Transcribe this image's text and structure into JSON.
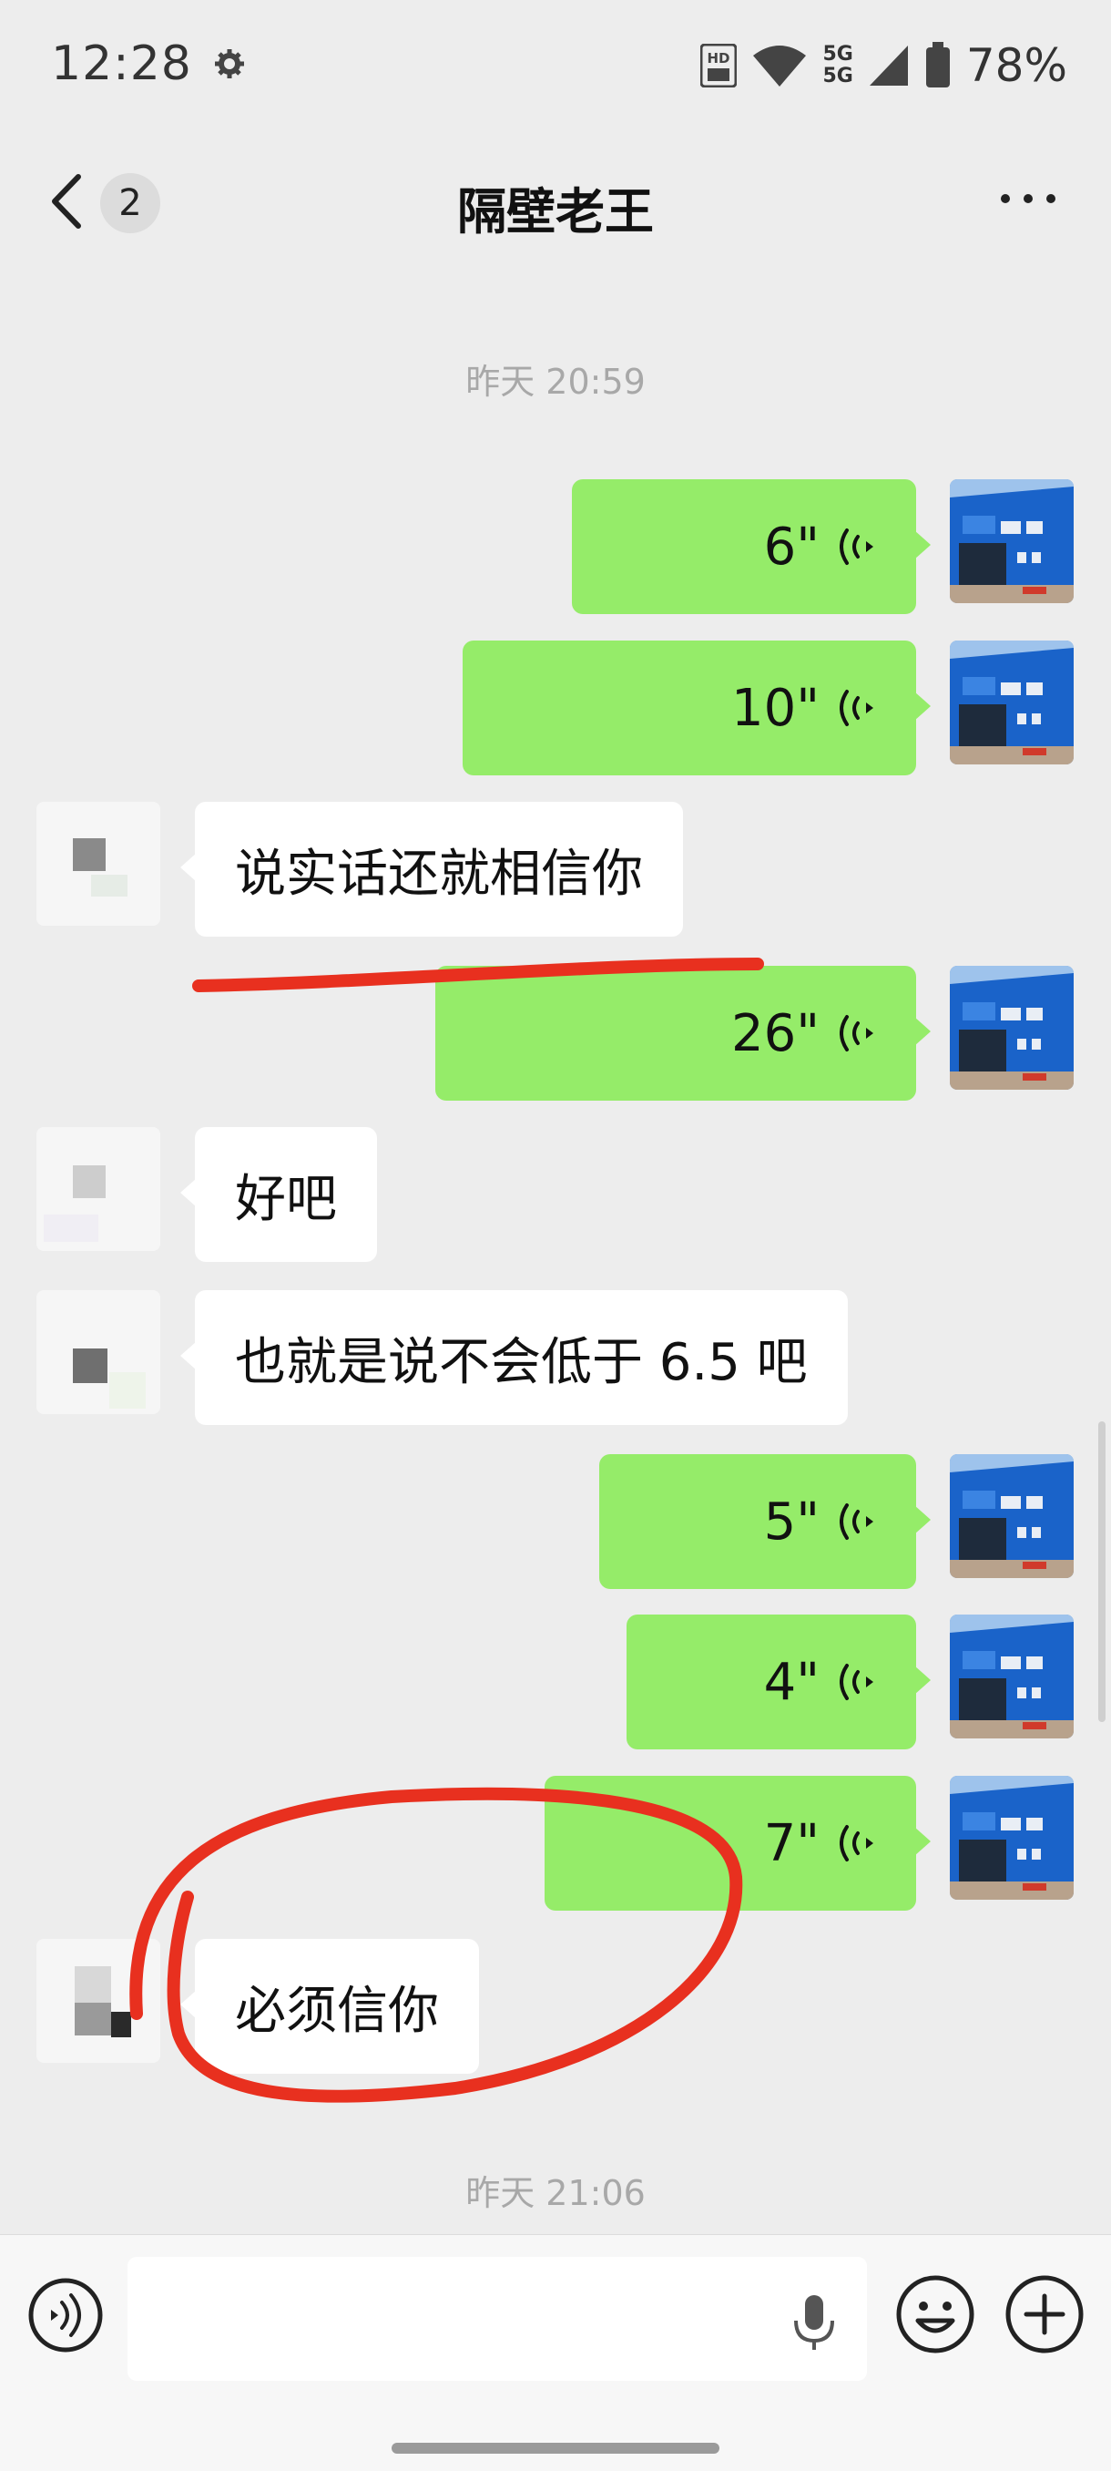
{
  "status_bar": {
    "time": "12:28",
    "battery": "78%",
    "network_top": "5G",
    "network_bottom": "5G",
    "hd_label": "HD"
  },
  "nav": {
    "back_badge": "2",
    "title": "隔壁老王"
  },
  "messages": [
    {
      "type": "timestamp",
      "text": "昨天 20:59"
    },
    {
      "type": "voice",
      "from": "me",
      "duration": "6\""
    },
    {
      "type": "voice",
      "from": "me",
      "duration": "10\""
    },
    {
      "type": "text",
      "from": "them",
      "text": "说实话还就相信你"
    },
    {
      "type": "voice",
      "from": "me",
      "duration": "26\""
    },
    {
      "type": "text",
      "from": "them",
      "text": "好吧"
    },
    {
      "type": "text",
      "from": "them",
      "text": "也就是说不会低于 6.5 吧"
    },
    {
      "type": "voice",
      "from": "me",
      "duration": "5\""
    },
    {
      "type": "voice",
      "from": "me",
      "duration": "4\""
    },
    {
      "type": "voice",
      "from": "me",
      "duration": "7\""
    },
    {
      "type": "text",
      "from": "them",
      "text": "必须信你"
    },
    {
      "type": "timestamp",
      "text": "昨天 21:06"
    }
  ],
  "avatar_me": {
    "sign_text": "66号车场"
  },
  "colors": {
    "background": "#ededed",
    "my_bubble": "#95ec69",
    "their_bubble": "#ffffff",
    "annotation_red": "#e8301f",
    "timestamp": "#a8a8a8"
  },
  "icons": [
    "back-arrow-icon",
    "more-icon",
    "voice-wave-icon",
    "voice-input-icon",
    "microphone-icon",
    "emoji-icon",
    "plus-icon",
    "wifi-icon",
    "battery-icon",
    "signal-icon"
  ]
}
